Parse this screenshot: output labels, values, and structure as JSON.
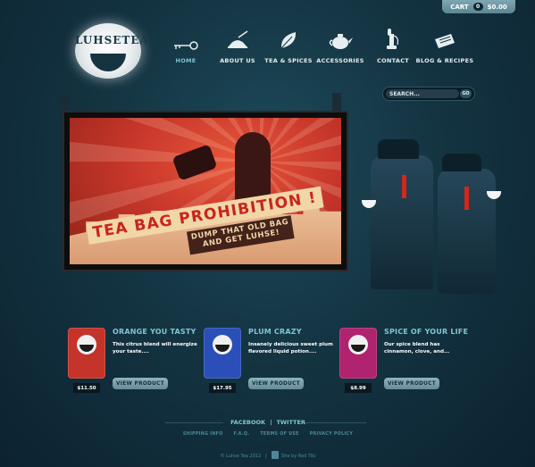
{
  "cart": {
    "label": "CART",
    "count": "0",
    "total": "$0.00"
  },
  "logo": {
    "text": "LUHSETEA"
  },
  "nav": [
    {
      "label": "HOME",
      "icon": "key-icon",
      "active": true
    },
    {
      "label": "ABOUT US",
      "icon": "cloche-icon",
      "active": false
    },
    {
      "label": "TEA & SPICES",
      "icon": "leaf-icon",
      "active": false
    },
    {
      "label": "ACCESSORIES",
      "icon": "teapot-icon",
      "active": false
    },
    {
      "label": "CONTACT",
      "icon": "telephone-icon",
      "active": false
    },
    {
      "label": "BLOG & RECIPES",
      "icon": "newspaper-icon",
      "active": false
    }
  ],
  "search": {
    "placeholder": "SEARCH...",
    "button": "GO"
  },
  "hero": {
    "headline": "TEA BAG PROHIBITION !",
    "tagline_line1": "DUMP THAT OLD BAG",
    "tagline_line2": "AND GET LUHSE!"
  },
  "products": [
    {
      "name": "ORANGE YOU TASTY",
      "description": "This citrus blend will energize your taste....",
      "price": "$11.50",
      "button": "VIEW PRODUCT",
      "color": "#c4342a"
    },
    {
      "name": "PLUM CRAZY",
      "description": "Insanely delicious sweet plum flavored liquid potion....",
      "price": "$17.95",
      "button": "VIEW PRODUCT",
      "color": "#2a4fb8"
    },
    {
      "name": "SPICE OF YOUR LIFE",
      "description": "Our spice blend has cinnamon, clove, and...",
      "price": "$8.99",
      "button": "VIEW PRODUCT",
      "color": "#b0236f"
    }
  ],
  "footer": {
    "social": [
      "FACEBOOK",
      "TWITTER"
    ],
    "links": [
      "SHIPPING INFO",
      "F.A.Q.",
      "TERMS OF USE",
      "PRIVACY POLICY"
    ],
    "copyright": "© Luhse Tea 2012",
    "credit": "Site by Red Tiki"
  },
  "colors": {
    "accent": "#7fc6d3",
    "background": "#143442",
    "cart": "#6d95a2"
  }
}
